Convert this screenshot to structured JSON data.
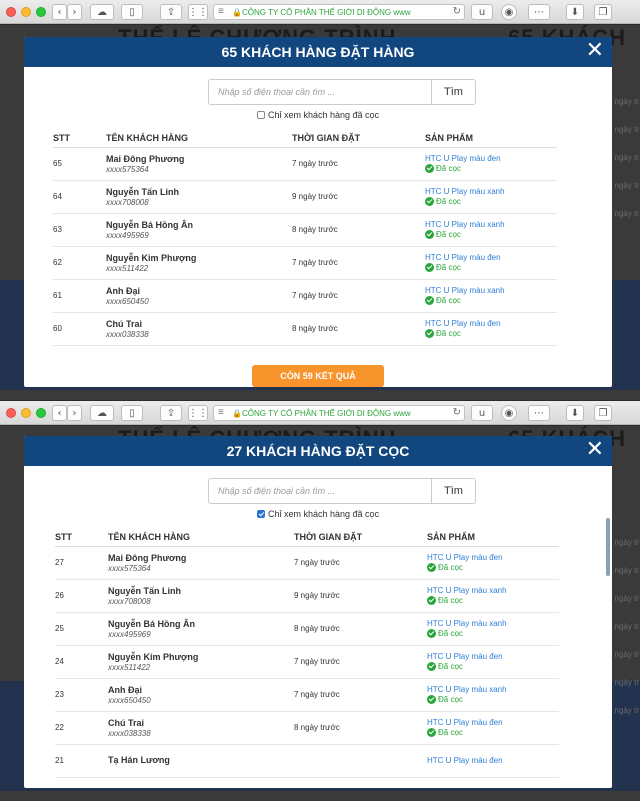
{
  "browser": {
    "url_text": "CÔNG TY CỔ PHẦN THẾ GIỚI DI ĐỘNG www",
    "reader_label": "u"
  },
  "background": {
    "heading_left": "THỂ LỆ CHƯƠNG TRÌNH",
    "heading_right": "65 KHÁCH",
    "side_labels": [
      "ngày tr",
      "ngày tr",
      "ngày tr",
      "ngày tr",
      "ngày tr",
      "ngày tr",
      "ngày tr"
    ]
  },
  "search": {
    "placeholder": "Nhập số điện thoại cần tìm ...",
    "button_label": "Tìm"
  },
  "deposit_filter_label": "Chỉ xem khách hàng đã cọc",
  "columns": {
    "stt": "STT",
    "name": "TÊN KHÁCH HÀNG",
    "time": "THỜI GIAN ĐẶT",
    "product": "SẢN PHẨM"
  },
  "status_label": "Đã cọc",
  "modals": [
    {
      "title": "65 KHÁCH HÀNG ĐẶT HÀNG",
      "deposit_checked": false,
      "more_button": "CÒN 59 KẾT QUẢ",
      "rows": [
        {
          "stt": "65",
          "name": "Mai Đông Phương",
          "phone": "xxxx575364",
          "time": "7 ngày trước",
          "product": "HTC U Play màu đen",
          "status": "Đã cọc"
        },
        {
          "stt": "64",
          "name": "Nguyễn Tấn Linh",
          "phone": "xxxx708008",
          "time": "9 ngày trước",
          "product": "HTC U Play màu xanh",
          "status": "Đã cọc"
        },
        {
          "stt": "63",
          "name": "Nguyễn Bá Hồng Ân",
          "phone": "xxxx495969",
          "time": "8 ngày trước",
          "product": "HTC U Play màu xanh",
          "status": "Đã cọc"
        },
        {
          "stt": "62",
          "name": "Nguyễn Kim Phượng",
          "phone": "xxxx511422",
          "time": "7 ngày trước",
          "product": "HTC U Play màu đen",
          "status": "Đã cọc"
        },
        {
          "stt": "61",
          "name": "Anh Đại",
          "phone": "xxxx650450",
          "time": "7 ngày trước",
          "product": "HTC U Play màu xanh",
          "status": "Đã cọc"
        },
        {
          "stt": "60",
          "name": "Chú Trai",
          "phone": "xxxx038338",
          "time": "8 ngày trước",
          "product": "HTC U Play màu đen",
          "status": "Đã cọc"
        }
      ]
    },
    {
      "title": "27 KHÁCH HÀNG ĐẶT CỌC",
      "deposit_checked": true,
      "rows": [
        {
          "stt": "27",
          "name": "Mai Đông Phương",
          "phone": "xxxx575364",
          "time": "7 ngày trước",
          "product": "HTC U Play màu đen",
          "status": "Đã cọc"
        },
        {
          "stt": "26",
          "name": "Nguyễn Tấn Linh",
          "phone": "xxxx708008",
          "time": "9 ngày trước",
          "product": "HTC U Play màu xanh",
          "status": "Đã cọc"
        },
        {
          "stt": "25",
          "name": "Nguyễn Bá Hồng Ân",
          "phone": "xxxx495969",
          "time": "8 ngày trước",
          "product": "HTC U Play màu xanh",
          "status": "Đã cọc"
        },
        {
          "stt": "24",
          "name": "Nguyễn Kim Phượng",
          "phone": "xxxx511422",
          "time": "7 ngày trước",
          "product": "HTC U Play màu đen",
          "status": "Đã cọc"
        },
        {
          "stt": "23",
          "name": "Anh Đại",
          "phone": "xxxx650450",
          "time": "7 ngày trước",
          "product": "HTC U Play màu xanh",
          "status": "Đã cọc"
        },
        {
          "stt": "22",
          "name": "Chú Trai",
          "phone": "xxxx038338",
          "time": "8 ngày trước",
          "product": "HTC U Play màu đen",
          "status": "Đã cọc"
        },
        {
          "stt": "21",
          "name": "Tạ Hán Lương",
          "phone": "",
          "time": "",
          "product": "HTC U Play màu đen",
          "status": ""
        }
      ]
    }
  ],
  "colors": {
    "header_blue": "#11467f",
    "link_blue": "#2f7fd6",
    "status_green": "#2aa53b",
    "button_orange": "#f7942b"
  }
}
